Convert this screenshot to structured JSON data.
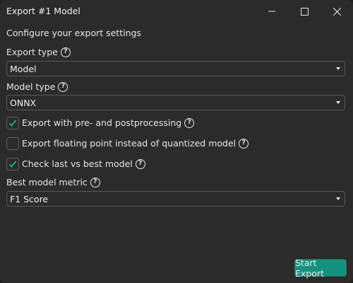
{
  "window": {
    "title": "Export #1 Model",
    "controls": [
      "minimize-icon",
      "maximize-icon",
      "close-icon"
    ]
  },
  "intro": "Configure your export settings",
  "export_type": {
    "label": "Export type",
    "value": "Model"
  },
  "model_type": {
    "label": "Model type",
    "value": "ONNX"
  },
  "checkboxes": [
    {
      "label": "Export with pre- and postprocessing",
      "checked": true
    },
    {
      "label": "Export floating point instead of quantized model",
      "checked": false
    },
    {
      "label": "Check last vs best model",
      "checked": true
    }
  ],
  "best_metric": {
    "label": "Best model metric",
    "value": "F1 Score"
  },
  "help_glyph": "?",
  "start_button": "Start Export",
  "colors": {
    "accent": "#15927f",
    "background": "#2b2b2b",
    "check": "#1aa38f"
  }
}
